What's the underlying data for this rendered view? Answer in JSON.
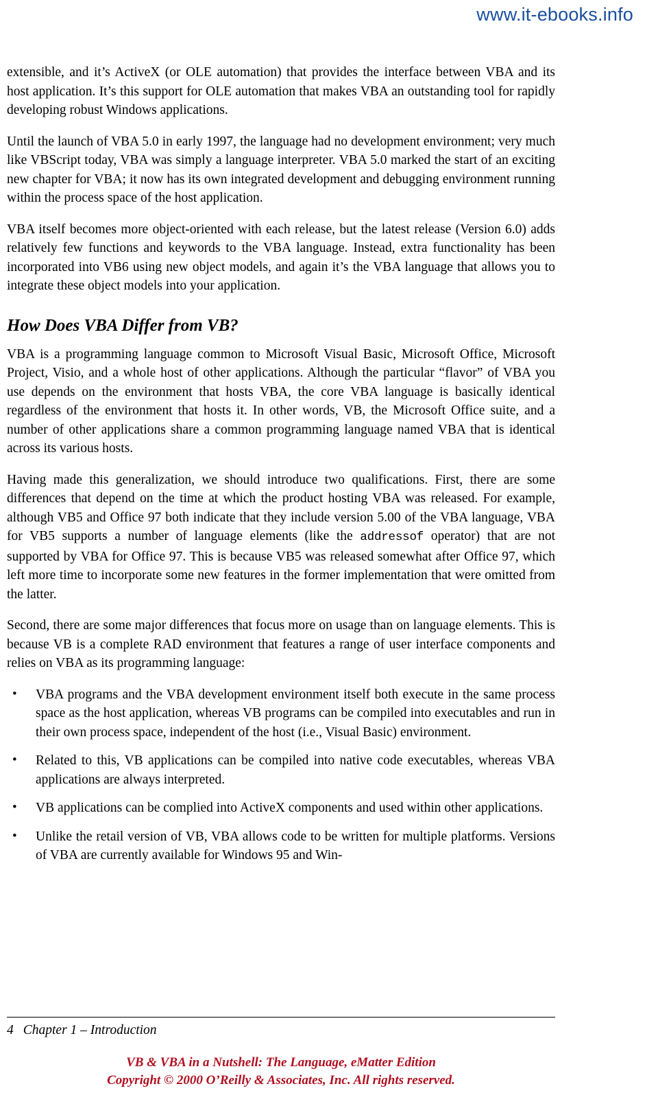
{
  "watermark": "www.it-ebooks.info",
  "body": {
    "para1_a": "extensible, and it’s ActiveX (or OLE automation) that provides the interface between VBA and its host application.",
    "para1_b": " It’s this support for OLE automation that makes VBA an outstanding tool for rapidly developing robust Windows applications.",
    "para2": "Until the launch of VBA 5.0 in early 1997, the language had no development environment; very much like VBScript today, VBA was simply a language interpreter. VBA 5.0 marked the start of an exciting new chapter for VBA; it now has its own integrated development and debugging environment running within the process space of the host application.",
    "para3": "VBA itself becomes more object-oriented with each release, but the latest release (Version 6.0) adds relatively few functions and keywords to the VBA language. Instead, extra functionality has been incorporated into VB6 using new object models, and again it’s the VBA language that allows you to integrate these object models into your application.",
    "section_heading": "How Does VBA Differ from VB?",
    "para4": "VBA is a programming language common to Microsoft Visual Basic, Microsoft Office, Microsoft Project, Visio, and a whole host of other applications. Although the particular “flavor” of VBA you use depends on the environment that hosts VBA, the core VBA language is basically identical regardless of the environment that hosts it. In other words, VB, the Microsoft Office suite, and a number of other applications share a common programming language named VBA that is identical across its various hosts.",
    "para5_a": "Having made this generalization, we should introduce two qualifications. First, there are some differences that depend on the time at which the product hosting VBA was released. For example, although VB5 and Office 97 both indicate that they include version 5.00 of the VBA language, VBA for VB5 supports a number of language elements (like the ",
    "para5_code": "addressof",
    "para5_b": " operator) that are not supported by VBA for Office 97. This is because VB5 was released somewhat after Office 97, which left more time to incorporate some new features in the former implementation that were omitted from the latter.",
    "para6": "Second, there are some major differences that focus more on usage than on language elements. This is because VB is a complete RAD environment that features a range of user interface components and relies on VBA as its programming language:",
    "bullets": [
      "VBA programs and the VBA development environment itself both execute in the same process space as the host application, whereas VB programs can be compiled into executables and run in their own process space, independent of the host (i.e., Visual Basic) environment.",
      "Related to this, VB applications can be compiled into native code executables, whereas VBA applications are always interpreted.",
      "VB applications can be complied into ActiveX components and used within other applications.",
      "Unlike the retail version of VB, VBA allows code to be written for multiple platforms. Versions of VBA are currently available for Windows 95 and Win-"
    ]
  },
  "footer": {
    "page_number": "4",
    "chapter_label": "Chapter 1 – Introduction",
    "colophon_line1": "VB & VBA in a Nutshell: The Language, eMatter Edition",
    "colophon_line2": "Copyright © 2000 O’Reilly & Associates, Inc. All rights reserved."
  }
}
